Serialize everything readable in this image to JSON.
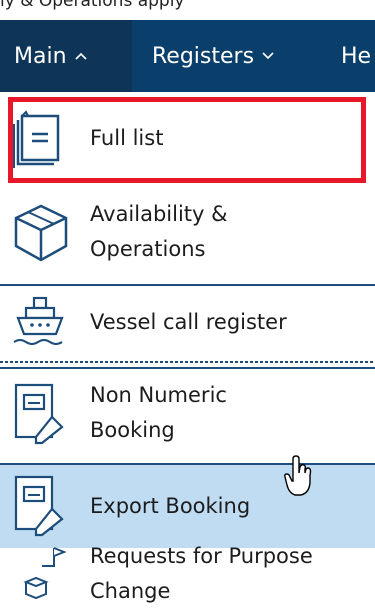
{
  "top_strip_text": "ly & Operations apply",
  "nav": {
    "items": [
      {
        "label": "Main",
        "chevron": "^",
        "expanded": true
      },
      {
        "label": "Registers",
        "chevron": "⌄",
        "expanded": false
      },
      {
        "label": "He",
        "chevron": "",
        "expanded": false
      }
    ]
  },
  "menu": {
    "items": [
      {
        "label": "Full list",
        "icon": "document-list-icon",
        "highlighted": true
      },
      {
        "label_line1": "Availability &",
        "label_line2": "Operations",
        "icon": "package-box-icon"
      },
      {
        "label": "Vessel call register",
        "icon": "ship-icon"
      },
      {
        "label_line1": "Non Numeric",
        "label_line2": "Booking",
        "icon": "booking-edit-icon"
      },
      {
        "label": "Export Booking",
        "icon": "booking-edit-icon",
        "hovered": true
      },
      {
        "label_line1": "Requests for Purpose",
        "label_line2": "Change",
        "icon": "purpose-change-icon"
      }
    ]
  },
  "colors": {
    "nav_bg": "#0b3f6b",
    "nav_active": "#0e3558",
    "hover_bg": "#bfdcf2",
    "highlight_border": "#e8182a",
    "separator": "#1d4d7a"
  }
}
